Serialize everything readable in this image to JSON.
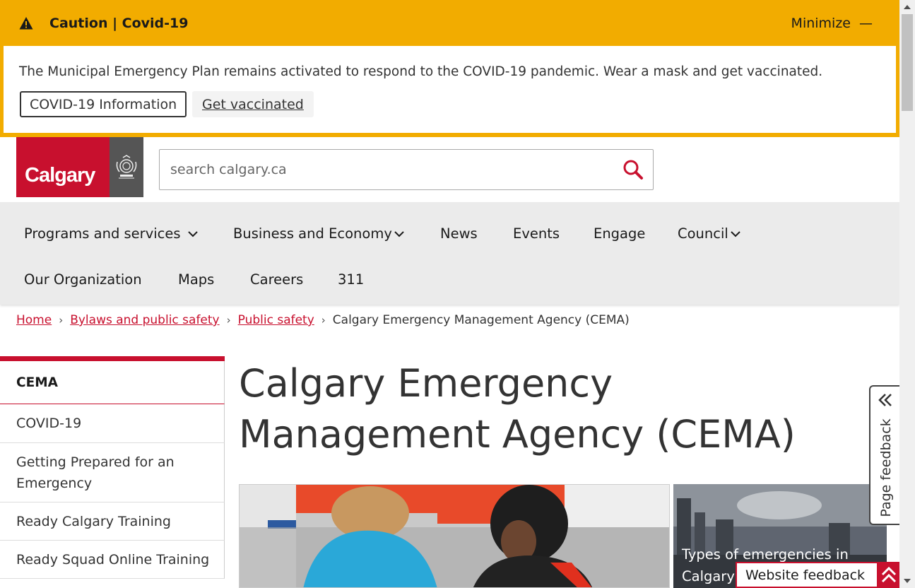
{
  "alert": {
    "title": "Caution | Covid-19",
    "minimize_label": "Minimize",
    "minimize_symbol": "—",
    "message": "The Municipal Emergency Plan remains activated to respond to the COVID-19 pandemic. Wear a mask and get vaccinated.",
    "covid_button": "COVID-19 Information",
    "vaccinated_link": "Get vaccinated",
    "color": "#f2ac00"
  },
  "header": {
    "logo_text": "Calgary",
    "search_placeholder": "search calgary.ca",
    "brand_color": "#c8102e"
  },
  "nav": {
    "items": [
      {
        "label": "Programs and services",
        "has_dropdown": true
      },
      {
        "label": "Business and Economy",
        "has_dropdown": true
      },
      {
        "label": "News"
      },
      {
        "label": "Events"
      },
      {
        "label": "Engage"
      },
      {
        "label": "Council",
        "has_dropdown": true
      },
      {
        "label": "Our Organization"
      },
      {
        "label": "Maps"
      },
      {
        "label": "Careers"
      },
      {
        "label": "311"
      }
    ]
  },
  "breadcrumb": {
    "items": [
      "Home",
      "Bylaws and public safety",
      "Public safety"
    ],
    "current": "Calgary Emergency Management Agency (CEMA)"
  },
  "sidebar": {
    "title": "CEMA",
    "items": [
      "COVID-19",
      "Getting Prepared for an Emergency",
      "Ready Calgary Training",
      "Ready Squad Online Training"
    ]
  },
  "main": {
    "title": "Calgary Emergency Management Agency (CEMA)",
    "card_caption": "Types of emergencies in Calgary"
  },
  "feedback": {
    "page_feedback": "Page feedback",
    "website_feedback": "Website feedback"
  }
}
